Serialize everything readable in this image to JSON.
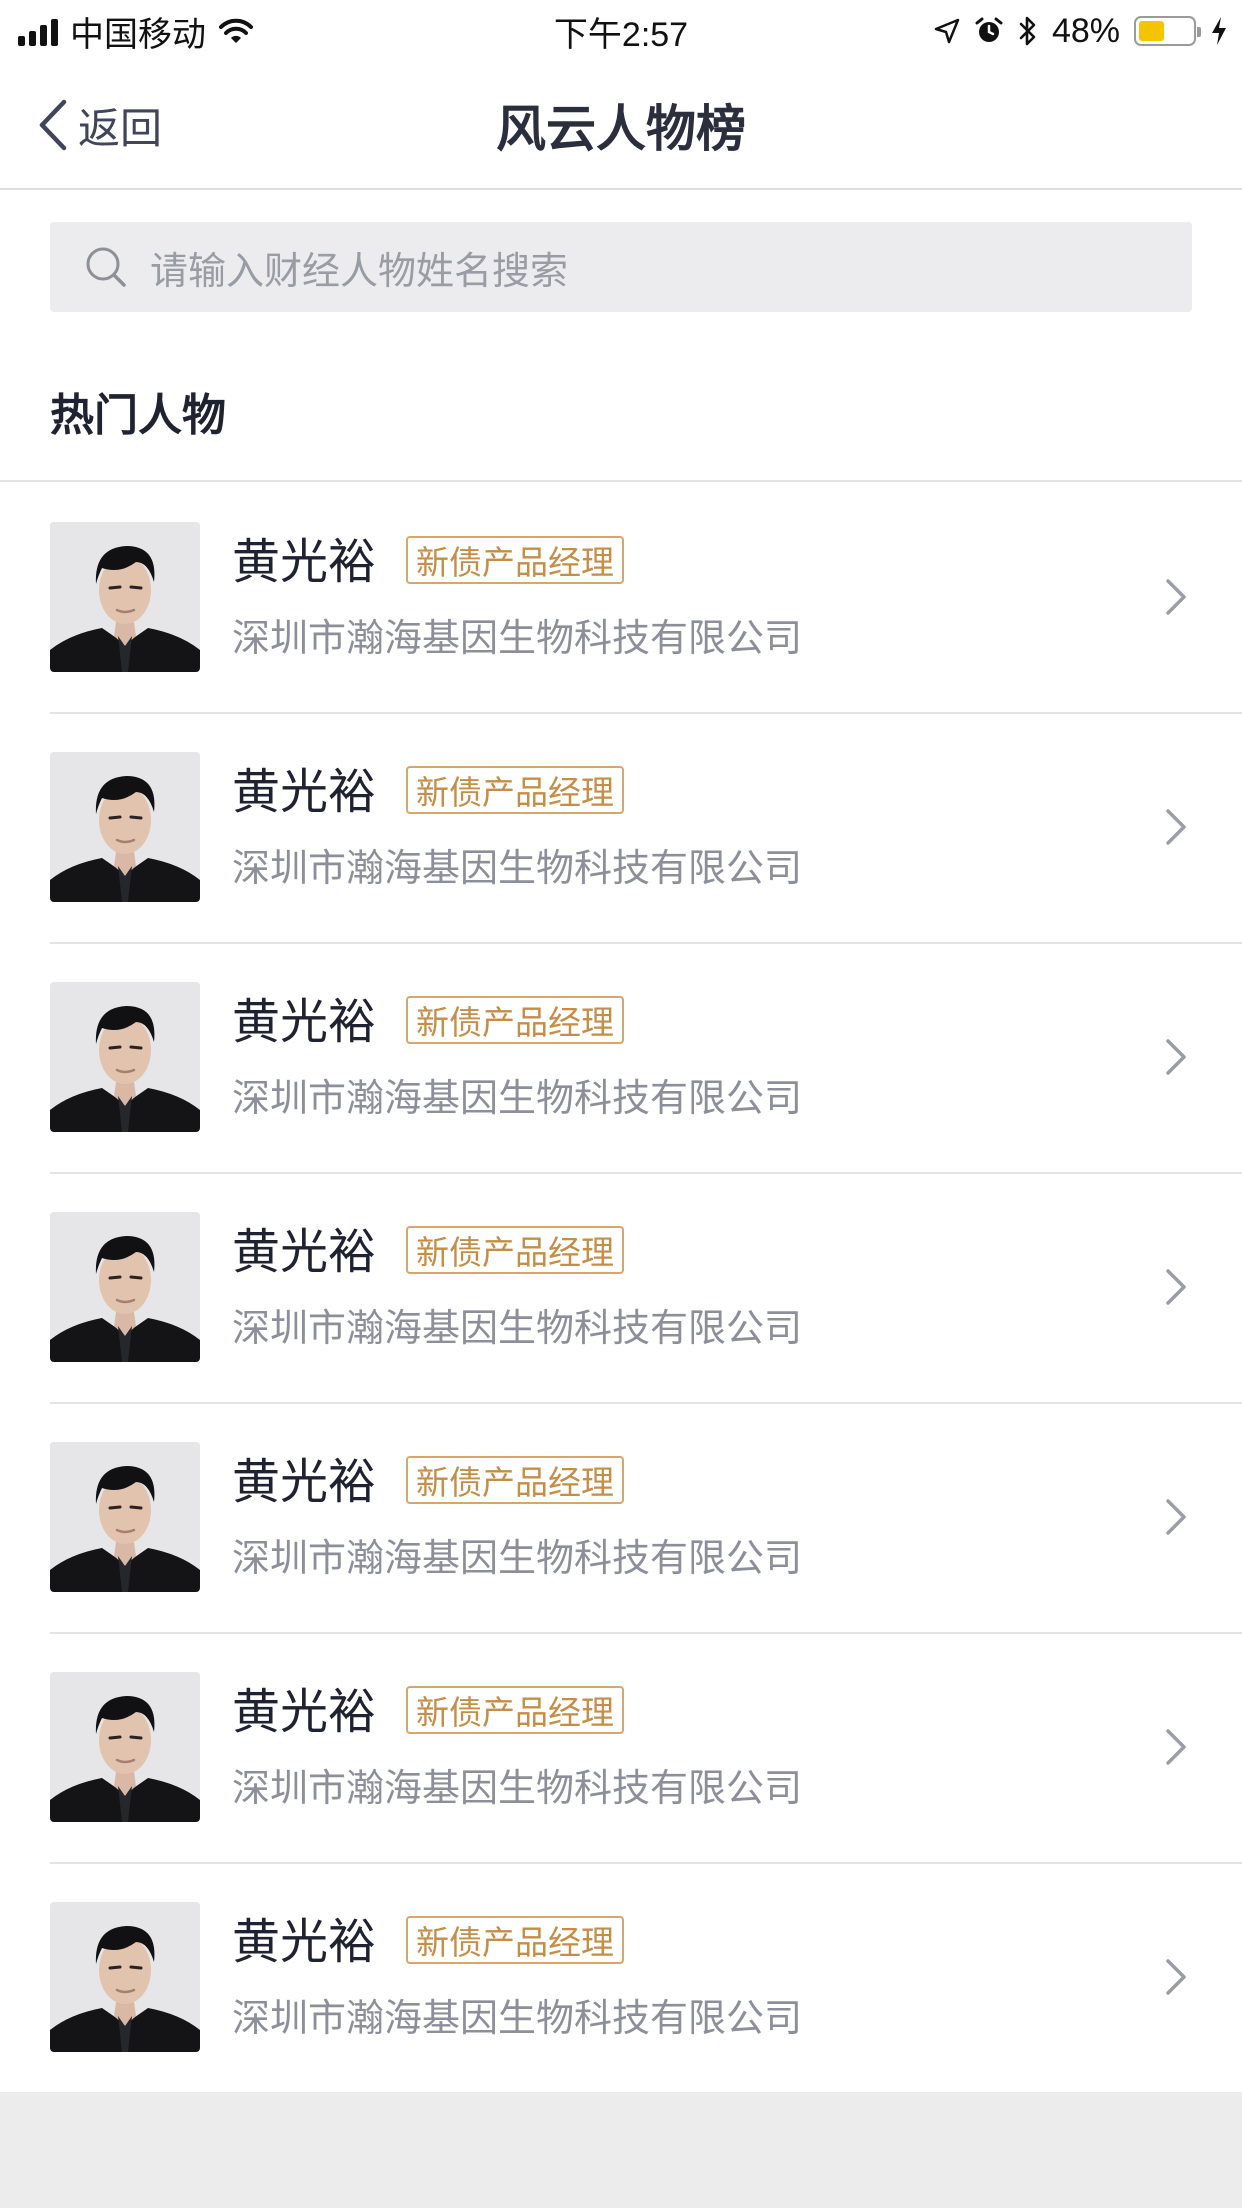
{
  "status_bar": {
    "carrier": "中国移动",
    "time": "下午2:57",
    "battery": "48%",
    "battery_level": 0.48,
    "icons": [
      "signal-icon",
      "wifi-icon",
      "location-icon",
      "alarm-icon",
      "bluetooth-icon",
      "battery-icon",
      "charging-icon"
    ]
  },
  "nav": {
    "back_label": "返回",
    "title": "风云人物榜"
  },
  "search": {
    "placeholder": "请输入财经人物姓名搜索"
  },
  "section": {
    "title": "热门人物"
  },
  "people": [
    {
      "name": "黄光裕",
      "tag": "新债产品经理",
      "company": "深圳市瀚海基因生物科技有限公司"
    },
    {
      "name": "黄光裕",
      "tag": "新债产品经理",
      "company": "深圳市瀚海基因生物科技有限公司"
    },
    {
      "name": "黄光裕",
      "tag": "新债产品经理",
      "company": "深圳市瀚海基因生物科技有限公司"
    },
    {
      "name": "黄光裕",
      "tag": "新债产品经理",
      "company": "深圳市瀚海基因生物科技有限公司"
    },
    {
      "name": "黄光裕",
      "tag": "新债产品经理",
      "company": "深圳市瀚海基因生物科技有限公司"
    },
    {
      "name": "黄光裕",
      "tag": "新债产品经理",
      "company": "深圳市瀚海基因生物科技有限公司"
    },
    {
      "name": "黄光裕",
      "tag": "新债产品经理",
      "company": "深圳市瀚海基因生物科技有限公司"
    }
  ],
  "colors": {
    "tag_border": "#d8a66a",
    "tag_text": "#c58d45",
    "battery_fill": "#f5c400"
  }
}
